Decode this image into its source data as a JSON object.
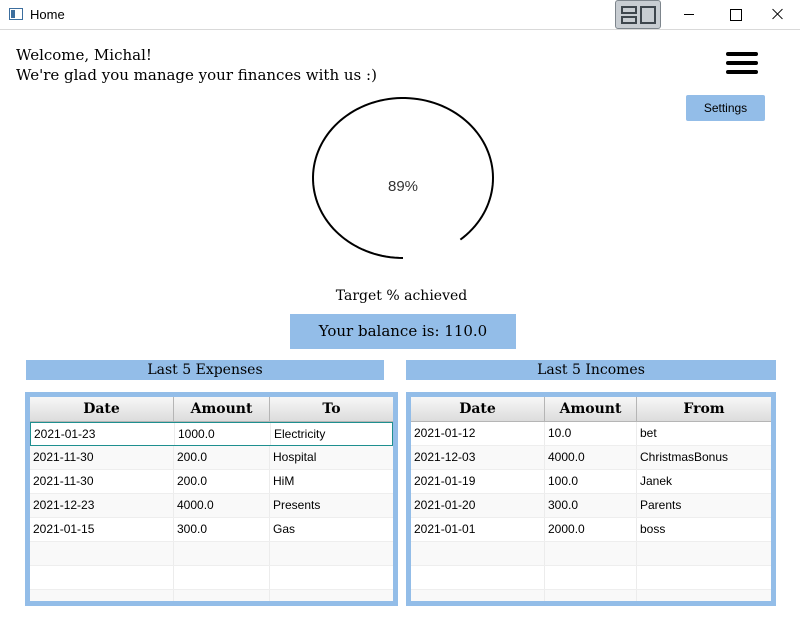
{
  "window": {
    "title": "Home"
  },
  "header": {
    "welcome_line1": "Welcome, Michal!",
    "welcome_line2": "We're glad you manage your finances with us :)",
    "settings_label": "Settings"
  },
  "progress": {
    "value": 0.89,
    "label": "89%",
    "caption": "Target % achieved"
  },
  "balance": {
    "text": "Your balance is: 110.0"
  },
  "expenses": {
    "title": "Last 5 Expenses",
    "columns": [
      "Date",
      "Amount",
      "To"
    ],
    "rows": [
      [
        "2021-01-23",
        "1000.0",
        "Electricity"
      ],
      [
        "2021-11-30",
        "200.0",
        "Hospital"
      ],
      [
        "2021-11-30",
        "200.0",
        "HiM"
      ],
      [
        "2021-12-23",
        "4000.0",
        "Presents"
      ],
      [
        "2021-01-15",
        "300.0",
        "Gas"
      ]
    ]
  },
  "incomes": {
    "title": "Last 5 Incomes",
    "columns": [
      "Date",
      "Amount",
      "From"
    ],
    "rows": [
      [
        "2021-01-12",
        "10.0",
        "bet"
      ],
      [
        "2021-12-03",
        "4000.0",
        "ChristmasBonus"
      ],
      [
        "2021-01-19",
        "100.0",
        "Janek"
      ],
      [
        "2021-01-20",
        "300.0",
        "Parents"
      ],
      [
        "2021-01-01",
        "2000.0",
        "boss"
      ]
    ]
  },
  "colors": {
    "accent": "#93bde8",
    "selection_border": "#1e8f8f"
  }
}
